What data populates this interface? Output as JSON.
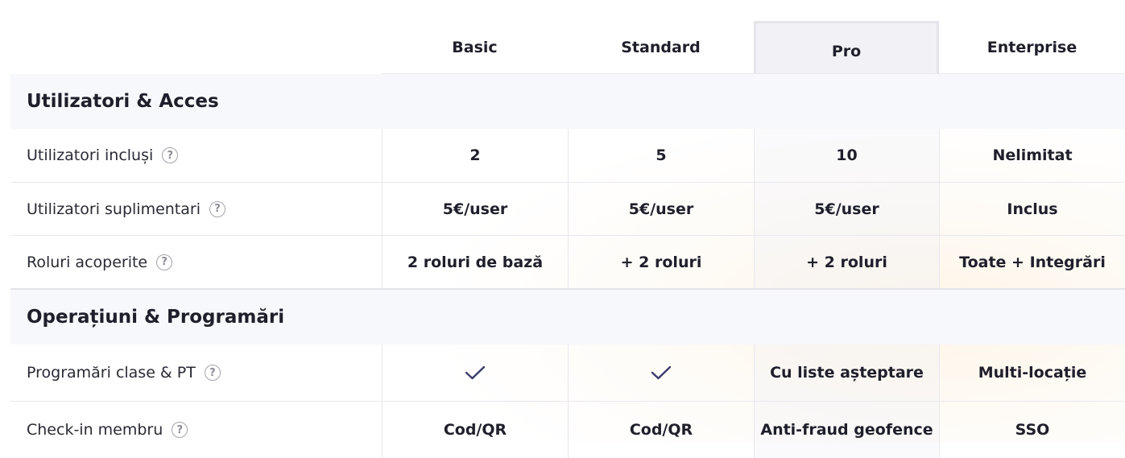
{
  "plans": [
    "Basic",
    "Standard",
    "Pro",
    "Enterprise"
  ],
  "sections": [
    {
      "title": "Utilizatori & Acces",
      "rows": [
        {
          "label": "Utilizatori incluși",
          "values": [
            "2",
            "5",
            "10",
            "Nelimitat"
          ]
        },
        {
          "label": "Utilizatori suplimentari",
          "values": [
            "5€/user",
            "5€/user",
            "5€/user",
            "Inclus"
          ]
        },
        {
          "label": "Roluri acoperite",
          "values": [
            "2 roluri de bază",
            "+ 2 roluri",
            "+ 2 roluri",
            "Toate + Integrări"
          ]
        }
      ]
    },
    {
      "title": "Operațiuni & Programări",
      "rows": [
        {
          "label": "Programări clase & PT",
          "values": [
            "check-icon",
            "check-icon",
            "Cu liste așteptare",
            "Multi-locație"
          ]
        },
        {
          "label": "Check-in membru",
          "values": [
            "Cod/QR",
            "Cod/QR",
            "Anti-fraud geofence",
            "SSO"
          ]
        }
      ]
    }
  ],
  "help_glyph": "?",
  "colors": {
    "highlight_column": "#f1f1f6",
    "section_background": "#f7f8fb",
    "check_color": "#3b3a6b"
  }
}
